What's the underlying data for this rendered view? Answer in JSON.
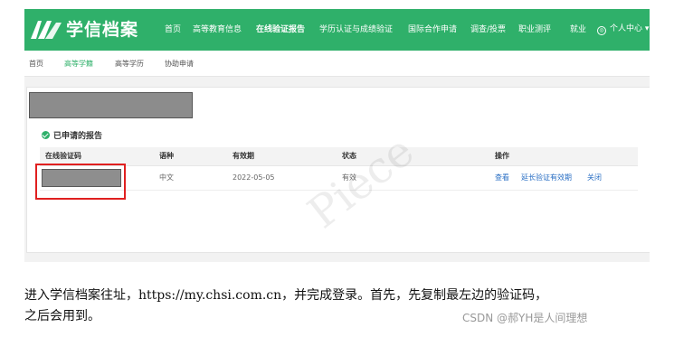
{
  "nav": {
    "brand": "学信档案",
    "items": [
      "首页",
      "高等教育信息",
      "在线验证报告",
      "学历认证与成绩验证",
      "国际合作申请",
      "调查/投票",
      "职业测评",
      "就业"
    ],
    "active_index": 2,
    "user_center": "个人中心"
  },
  "subnav": {
    "items": [
      "首页",
      "高等学籍",
      "高等学历",
      "协助申请"
    ],
    "active_index": 1
  },
  "section": {
    "title": "已申请的报告"
  },
  "table": {
    "headers": [
      "在线验证码",
      "语种",
      "有效期",
      "状态",
      "操作"
    ],
    "rows": [
      {
        "code": "",
        "language": "中文",
        "valid_until": "2022-05-05",
        "status": "有效",
        "actions": [
          "查看",
          "延长验证有效期",
          "关闭"
        ]
      }
    ]
  },
  "caption": {
    "line1": "进入学信档案往址，https://my.chsi.com.cn，并完成登录。首先，先复制最左边的验证码，",
    "line2": "之后会用到。"
  },
  "watermark": {
    "text": "CSDN @郝YH是人间理想",
    "diagonal": "Piece"
  },
  "colors": {
    "brand_green": "#2fb06a",
    "link_blue": "#2a6fc4",
    "highlight_red": "#e02020"
  }
}
